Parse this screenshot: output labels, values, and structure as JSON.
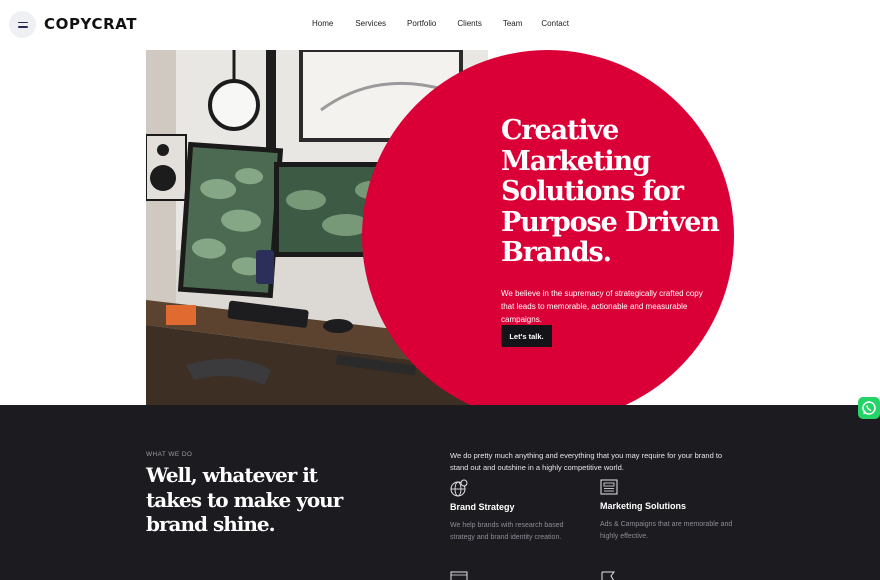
{
  "header": {
    "logo": "COPYCRAT",
    "menu_icon": "hamburger-menu-icon",
    "nav": [
      "Home",
      "Services",
      "Portfolio",
      "Clients",
      "Team",
      "Contact"
    ]
  },
  "hero": {
    "title": "Creative Marketing Solutions for Purpose Driven Brands.",
    "subtitle": "We believe in the supremacy of strategically crafted copy that leads to memorable, actionable and measurable campaigns.",
    "cta_label": "Let's talk.",
    "accent_color": "#da0037"
  },
  "what_we_do": {
    "eyebrow": "WHAT WE DO",
    "heading": "Well, whatever it takes to make your brand shine.",
    "intro": "We do pretty much anything and everything that you may require for your brand to stand out and outshine in a highly competitive world.",
    "services": [
      {
        "icon": "globe-icon",
        "title": "Brand Strategy",
        "desc": "We help brands with research based strategy and brand identity creation."
      },
      {
        "icon": "newspaper-icon",
        "title": "Marketing Solutions",
        "desc": "Ads & Campaigns that are memorable and highly effective."
      }
    ]
  },
  "floating": {
    "icon": "whatsapp-icon"
  }
}
